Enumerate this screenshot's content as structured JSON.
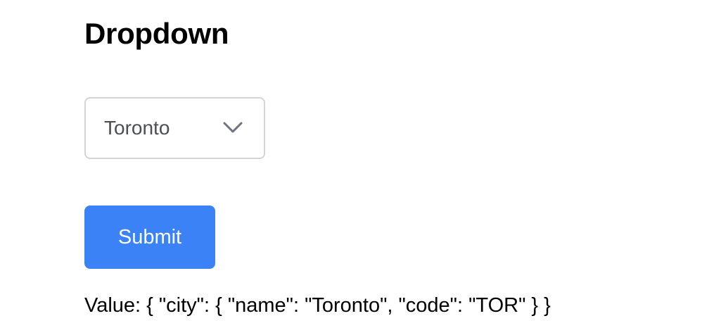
{
  "title": "Dropdown",
  "dropdown": {
    "selected": "Toronto",
    "icon": "chevron-down-icon"
  },
  "submit_label": "Submit",
  "value_text": "Value: { \"city\": { \"name\": \"Toronto\", \"code\": \"TOR\" } }",
  "colors": {
    "primary": "#3b82f6",
    "border": "#d1d5db",
    "selected_text": "#4b4f55",
    "chevron": "#6b7280"
  }
}
